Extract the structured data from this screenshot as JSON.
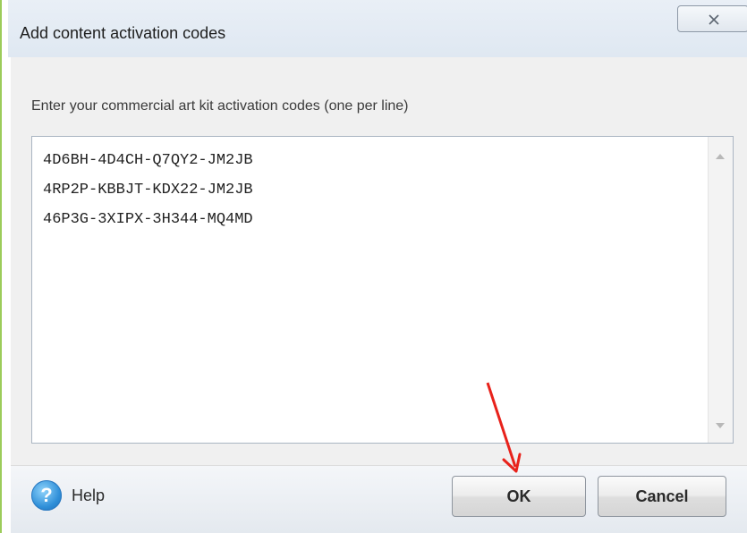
{
  "dialog": {
    "title": "Add content activation codes",
    "close_icon": "close-icon"
  },
  "main": {
    "instruction": "Enter your commercial art kit activation codes (one per line)",
    "codes": "4D6BH-4D4CH-Q7QY2-JM2JB\n4RP2P-KBBJT-KDX22-JM2JB\n46P3G-3XIPX-3H344-MQ4MD"
  },
  "footer": {
    "help_icon": "question-mark-icon",
    "help_label": "Help",
    "ok_label": "OK",
    "cancel_label": "Cancel"
  },
  "annotation": {
    "arrow_icon": "red-arrow-icon",
    "color": "#e8221b"
  }
}
